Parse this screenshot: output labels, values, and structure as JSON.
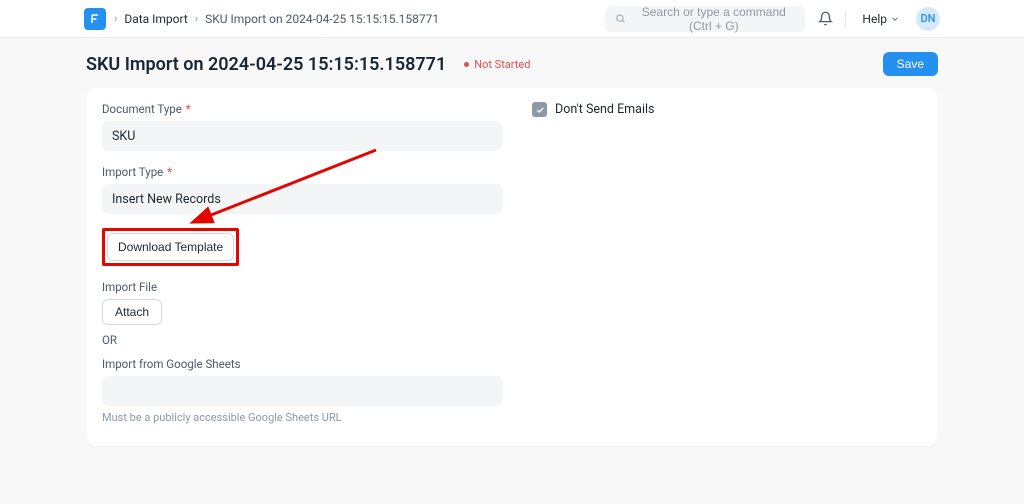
{
  "breadcrumb": {
    "item1": "Data Import",
    "item2": "SKU Import on 2024-04-25 15:15:15.158771"
  },
  "search": {
    "placeholder": "Search or type a command (Ctrl + G)"
  },
  "help_label": "Help",
  "avatar_initials": "DN",
  "page": {
    "title": "SKU Import on 2024-04-25 15:15:15.158771",
    "status": "Not Started",
    "save": "Save"
  },
  "form": {
    "document_type_label": "Document Type",
    "document_type_value": "SKU",
    "import_type_label": "Import Type",
    "import_type_value": "Insert New Records",
    "download_template": "Download Template",
    "import_file_label": "Import File",
    "attach": "Attach",
    "or": "OR",
    "gsheets_label": "Import from Google Sheets",
    "gsheets_hint": "Must be a publicly accessible Google Sheets URL",
    "dont_send_emails": "Don't Send Emails"
  }
}
